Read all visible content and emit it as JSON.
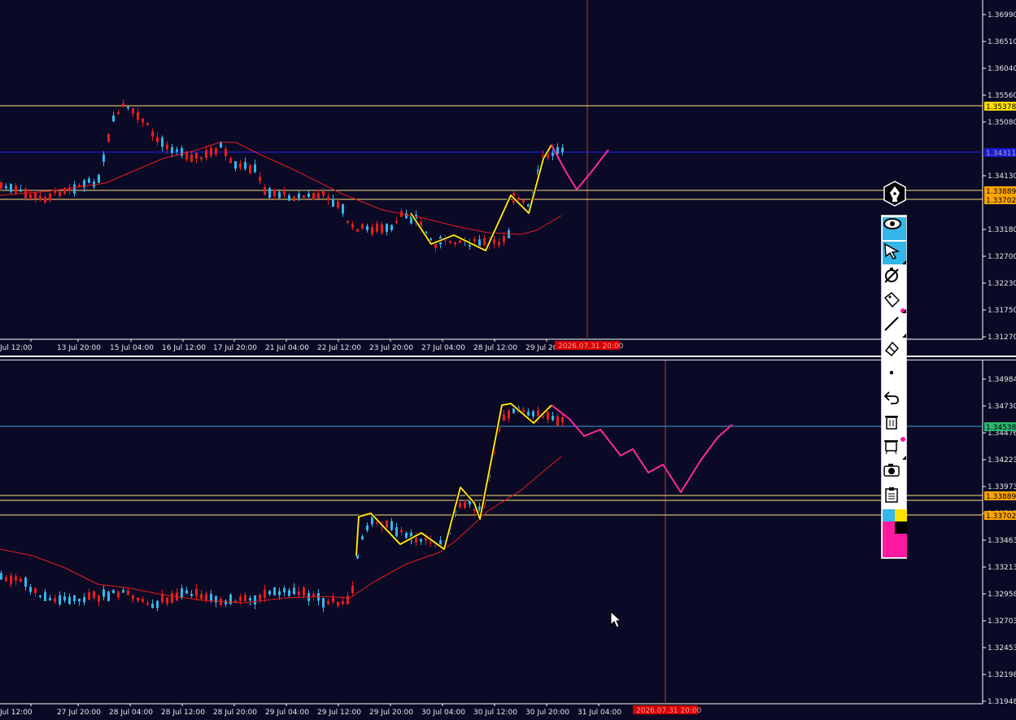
{
  "colors": {
    "background": "#0a0a26",
    "grid_axis": "#ffffff",
    "bull": "#35b6e8",
    "bear": "#e81c1c",
    "ma": "#e81c1c",
    "zigzag": "#ffe01a",
    "forecast": "#ff2a9a",
    "level_line": "#ffe07a",
    "level_tag_yellow": "#ffe000",
    "level_tag_orange": "#ffa500",
    "current_top": "#2020ff",
    "current_bottom": "#3aa0e0",
    "crosshair": "#c0392b"
  },
  "top_chart": {
    "y_ticks": [
      "1.36990",
      "1.36510",
      "1.36040",
      "1.35560",
      "1.35080",
      "1.34130",
      "1.33180",
      "1.32700",
      "1.32230",
      "1.31750",
      "1.31270"
    ],
    "x_ticks": [
      "Jul 12:00",
      "13 Jul 20:00",
      "15 Jul 04:00",
      "16 Jul 12:00",
      "17 Jul 20:00",
      "21 Jul 04:00",
      "22 Jul 12:00",
      "23 Jul 20:00",
      "27 Jul 04:00",
      "28 Jul 12:00",
      "29 Jul 20:00"
    ],
    "crosshair_time": "2026.07.31 20:00",
    "price_tags": [
      "1.35378",
      "1.33889",
      "1.33702"
    ],
    "current_price_tag": "1.34311"
  },
  "bottom_chart": {
    "y_ticks": [
      "1.34984",
      "1.34730",
      "1.34476",
      "1.34223",
      "1.33973",
      "1.33717",
      "1.33463",
      "1.33213",
      "1.32958",
      "1.32703",
      "1.32453",
      "1.32198",
      "1.31948"
    ],
    "x_ticks": [
      "Jul 12:00",
      "27 Jul 20:00",
      "28 Jul 04:00",
      "28 Jul 12:00",
      "28 Jul 20:00",
      "29 Jul 04:00",
      "29 Jul 12:00",
      "29 Jul 20:00",
      "30 Jul 04:00",
      "30 Jul 12:00",
      "30 Jul 20:00",
      "31 Jul 04:00"
    ],
    "crosshair_time": "2026.07.31 20:00",
    "price_tags": [
      "1.33889",
      "1.33702"
    ],
    "current_price_tag": "1.34538"
  },
  "toolbar": {
    "buttons": [
      "eye-icon",
      "cursor-icon",
      "no-stopwatch-icon",
      "tag-icon",
      "line-icon",
      "eraser-icon",
      "dot-icon",
      "undo-icon",
      "trash-icon",
      "trash-marked-icon",
      "camera-icon",
      "clipboard-icon"
    ],
    "swatches": [
      "#35b6e8",
      "#ffe000",
      "#ff1aa0",
      "#000000"
    ]
  }
}
